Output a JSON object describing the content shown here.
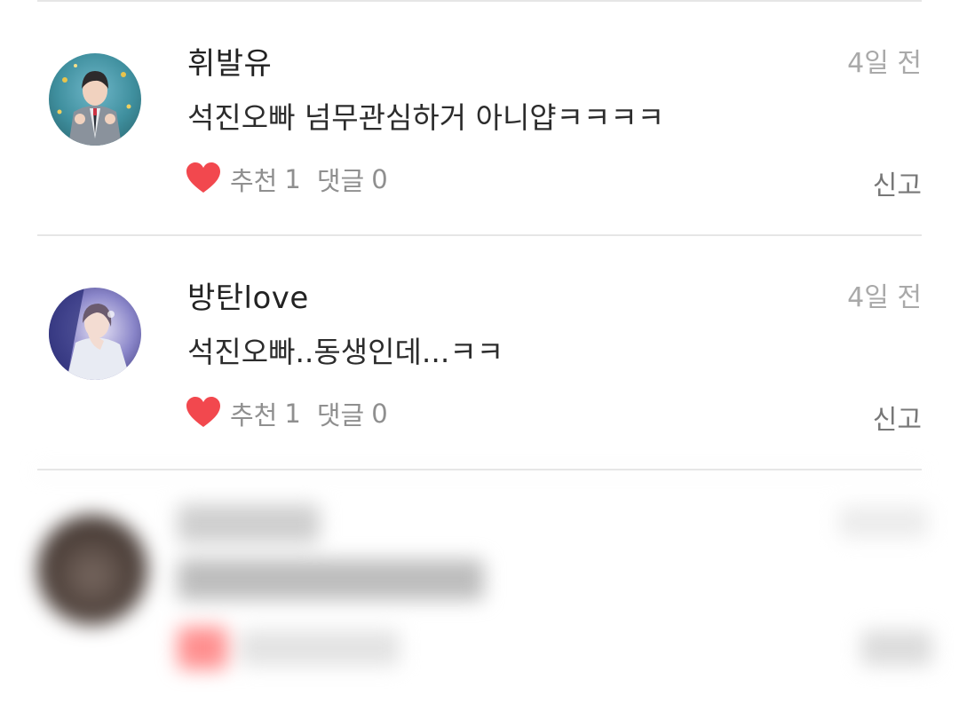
{
  "comments": [
    {
      "username": "휘발유",
      "time": "4일 전",
      "text": "석진오빠 넘무관심하거 아니얍ㅋㅋㅋㅋ",
      "recommend_label": "추천",
      "recommend_count": "1",
      "reply_label": "댓글",
      "reply_count": "0",
      "report_label": "신고",
      "avatar_icon": "profile-photo"
    },
    {
      "username": "방탄love",
      "time": "4일 전",
      "text": "석진오빠..동생인데...ㅋㅋ",
      "recommend_label": "추천",
      "recommend_count": "1",
      "reply_label": "댓글",
      "reply_count": "0",
      "report_label": "신고",
      "avatar_icon": "profile-photo"
    }
  ],
  "colors": {
    "heart": "#f2484e",
    "secondary_text": "#8f8f8f",
    "divider": "#e6e6e6"
  },
  "icons": [
    "heart-icon"
  ]
}
